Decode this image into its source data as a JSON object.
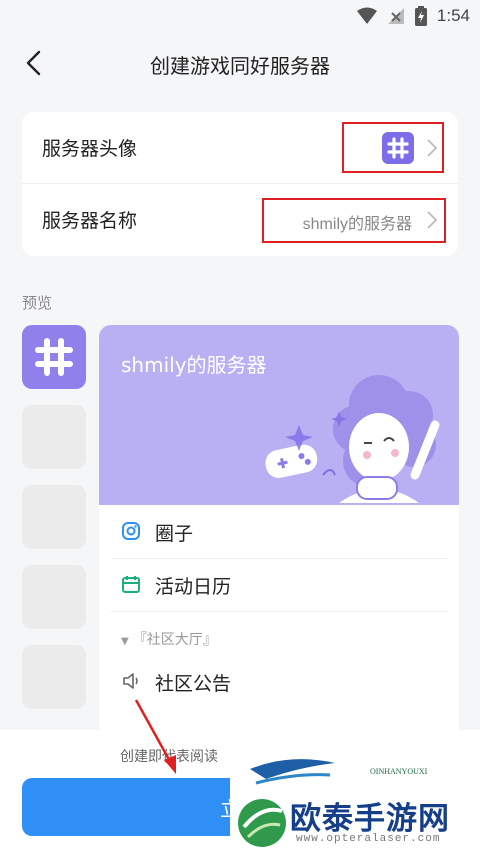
{
  "status": {
    "time": "1:54"
  },
  "header": {
    "title": "创建游戏同好服务器"
  },
  "settings": {
    "avatar_label": "服务器头像",
    "name_label": "服务器名称",
    "name_value": "shmily的服务器"
  },
  "preview": {
    "label": "预览",
    "server_name": "shmily的服务器",
    "items": [
      {
        "label": "圈子",
        "icon": "instagram-icon"
      },
      {
        "label": "活动日历",
        "icon": "calendar-icon"
      }
    ],
    "section_title": "『社区大厅』",
    "channel": {
      "label": "社区公告",
      "icon": "speaker-icon"
    }
  },
  "footer": {
    "agree_text": "创建即代表阅读",
    "create_button": "立即"
  },
  "watermark": {
    "brand": "欧泰手游网",
    "url": "www.opteralaser.com",
    "small": "OINHANYOUXI"
  },
  "colors": {
    "accent_purple": "#7d6ee8",
    "banner_purple": "#b9aff3",
    "primary_blue": "#2f8ff5",
    "highlight_red": "#e02020"
  }
}
